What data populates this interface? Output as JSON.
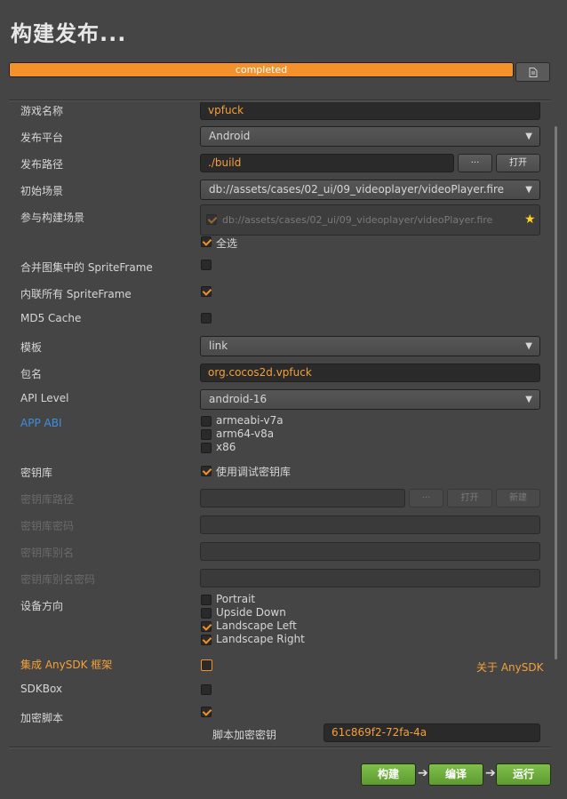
{
  "window": {
    "title": "构建发布..."
  },
  "progress": {
    "value": 1.0,
    "text": "completed"
  },
  "fields": {
    "game_name_label": "游戏名称",
    "game_name_value": "vpfuck",
    "platform_label": "发布平台",
    "platform_value": "Android",
    "path_label": "发布路径",
    "path_value": "./build",
    "path_browse": "···",
    "path_open": "打开",
    "start_scene_label": "初始场景",
    "start_scene_value": "db://assets/cases/02_ui/09_videoplayer/videoPlayer.fire",
    "build_scenes_label": "参与构建场景",
    "build_scene_item": "db://assets/cases/02_ui/09_videoplayer/videoPlayer.fire",
    "select_all": "全选",
    "merge_sf_label": "合并图集中的 SpriteFrame",
    "inline_sf_label": "内联所有 SpriteFrame",
    "md5_label": "MD5 Cache",
    "template_label": "模板",
    "template_value": "link",
    "package_label": "包名",
    "package_value": "org.cocos2d.vpfuck",
    "api_label": "API Level",
    "api_value": "android-16",
    "abi_label": "APP ABI",
    "abi_options": [
      "armeabi-v7a",
      "arm64-v8a",
      "x86"
    ],
    "keystore_label": "密钥库",
    "keystore_debug": "使用调试密钥库",
    "keystore_path_label": "密钥库路径",
    "keystore_browse": "···",
    "keystore_open": "打开",
    "keystore_new": "新建",
    "keystore_pwd_label": "密钥库密码",
    "keystore_alias_label": "密钥库别名",
    "keystore_alias_pwd_label": "密钥库别名密码",
    "orientation_label": "设备方向",
    "orientations": [
      "Portrait",
      "Upside Down",
      "Landscape Left",
      "Landscape Right"
    ],
    "anysdk_label": "集成 AnySDK 框架",
    "anysdk_link": "关于 AnySDK",
    "sdkbox_label": "SDKBox",
    "encrypt_label": "加密脚本",
    "encrypt_key_label": "脚本加密密钥",
    "encrypt_key_value": "61c869f2-72fa-4a"
  },
  "buttons": {
    "build": "构建",
    "compile": "编译",
    "run": "运行"
  },
  "colors": {
    "accent": "#f5912b",
    "link_blue": "#3e8fe0",
    "green_button": "#6aa83a"
  }
}
